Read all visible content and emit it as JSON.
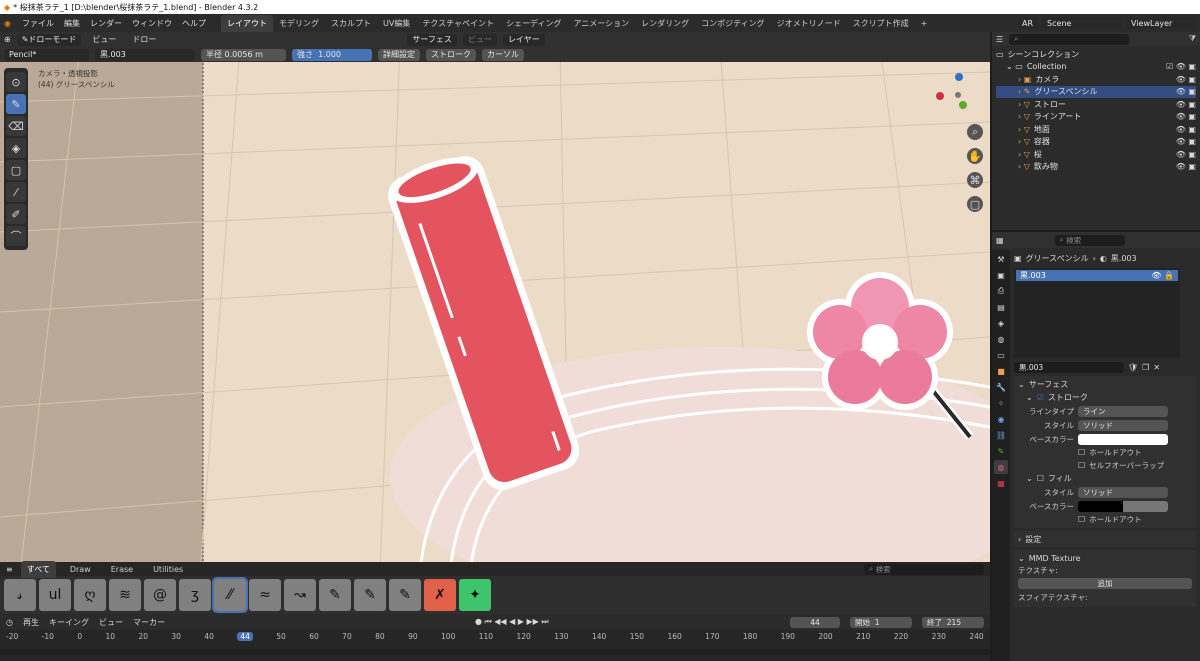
{
  "window": {
    "title": "* 桜抹茶ラテ_1 [D:\\blender\\桜抹茶ラテ_1.blend] - Blender 4.3.2"
  },
  "menu": [
    "ファイル",
    "編集",
    "レンダー",
    "ウィンドウ",
    "ヘルプ"
  ],
  "workspaces": [
    "レイアウト",
    "モデリング",
    "スカルプト",
    "UV編集",
    "テクスチャペイント",
    "シェーディング",
    "アニメーション",
    "レンダリング",
    "コンポジティング",
    "ジオメトリノード",
    "スクリプト作成",
    "+"
  ],
  "active_workspace": "レイアウト",
  "topright": {
    "ar": "AR",
    "scene": "Scene",
    "viewlayer": "ViewLayer"
  },
  "vp_header": {
    "mode": "ドローモード",
    "view": "ビュー",
    "draw": "ドロー",
    "brush": "Pencil*",
    "material": "黒.003",
    "placement": "サーフェス",
    "view2": "ビュー",
    "layer": "レイヤー",
    "radius_label": "半径",
    "radius_value": "0.0056 m",
    "strength_label": "強さ",
    "strength_value": "1.000",
    "advanced": "詳細設定",
    "stroke": "ストローク",
    "cursor": "カーソル"
  },
  "viewport": {
    "camera_text": "カメラ・透視投影",
    "object_text": "(44) グリースペンシル"
  },
  "gizmo": {
    "x": "X",
    "y": "Y",
    "z": "Z"
  },
  "brush_panel": {
    "tabs": [
      "すべて",
      "Draw",
      "Erase",
      "Utilities"
    ],
    "active_tab": "すべて",
    "search_placeholder": "検索",
    "tiles": [
      "𝓈",
      "ul",
      "ღ",
      "≋",
      "@",
      "ʒ",
      "⁄⁄",
      "≈",
      "↝",
      "✎",
      "✎",
      "✎",
      "✗",
      "✦"
    ]
  },
  "timeline": {
    "playback": "再生",
    "keying": "キーイング",
    "view": "ビュー",
    "marker": "マーカー",
    "current_frame": "44",
    "start_label": "開始",
    "start": "1",
    "end_label": "終了",
    "end": "215",
    "ticks": [
      "-20",
      "-10",
      "0",
      "10",
      "20",
      "30",
      "40",
      "44",
      "50",
      "60",
      "70",
      "80",
      "90",
      "100",
      "110",
      "120",
      "130",
      "140",
      "150",
      "160",
      "170",
      "180",
      "190",
      "200",
      "210",
      "220",
      "230",
      "240"
    ]
  },
  "outliner": {
    "root": "シーンコレクション",
    "collection": "Collection",
    "items": [
      "カメラ",
      "グリースペンシル",
      "ストロー",
      "ラインアート",
      "地面",
      "容器",
      "桜",
      "飲み物"
    ],
    "selected": "グリースペンシル",
    "search_placeholder": "検索"
  },
  "properties": {
    "search_placeholder": "検索",
    "breadcrumb_object": "グリースペンシル",
    "breadcrumb_material": "黒.003",
    "slot_name": "黒.003",
    "material_field": "黒.003",
    "surface_header": "サーフェス",
    "stroke_label": "ストローク",
    "line_type_label": "ラインタイプ",
    "line_type_value": "ライン",
    "style_label": "スタイル",
    "style_value": "ソリッド",
    "base_color_label": "ベースカラー",
    "holdout_label": "ホールドアウト",
    "self_overlap_label": "セルフオーバーラップ",
    "fill_label": "フィル",
    "fill_style_label": "スタイル",
    "fill_style_value": "ソリッド",
    "fill_base_color_label": "ベースカラー",
    "fill_holdout_label": "ホールドアウト",
    "settings_header": "設定",
    "mmd_header": "MMD Texture",
    "texture_label": "テクスチャ:",
    "add_button": "追加",
    "sphere_label": "スフィアテクスチャ:"
  },
  "colors": {
    "accent": "#4772b3",
    "straw": "#e3545e",
    "bg_viewport": "#ecdcc7",
    "stroke_color": "#ffffff",
    "fill_color": "#000000"
  }
}
